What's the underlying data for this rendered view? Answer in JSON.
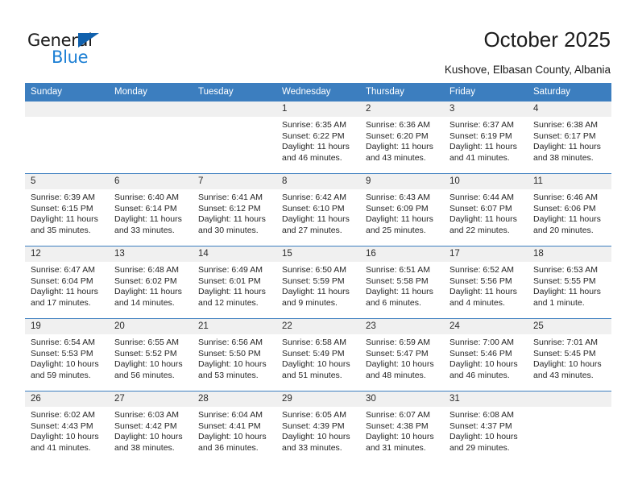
{
  "brand": {
    "name_top": "General",
    "name_bottom": "Blue",
    "triangle_color": "#1161ad",
    "blue_text_color": "#1c7fd4"
  },
  "header": {
    "title": "October 2025",
    "subtitle": "Kushove, Elbasan County, Albania"
  },
  "theme": {
    "header_blue": "#3c7ebf",
    "daynum_band": "#f0f0f0",
    "text_color": "#262626",
    "page_background": "#ffffff"
  },
  "calendar": {
    "weekday_headers": [
      "Sunday",
      "Monday",
      "Tuesday",
      "Wednesday",
      "Thursday",
      "Friday",
      "Saturday"
    ],
    "weeks": [
      [
        {
          "day": "",
          "empty": true
        },
        {
          "day": "",
          "empty": true
        },
        {
          "day": "",
          "empty": true
        },
        {
          "day": "1",
          "sunrise": "Sunrise: 6:35 AM",
          "sunset": "Sunset: 6:22 PM",
          "daylight": "Daylight: 11 hours and 46 minutes."
        },
        {
          "day": "2",
          "sunrise": "Sunrise: 6:36 AM",
          "sunset": "Sunset: 6:20 PM",
          "daylight": "Daylight: 11 hours and 43 minutes."
        },
        {
          "day": "3",
          "sunrise": "Sunrise: 6:37 AM",
          "sunset": "Sunset: 6:19 PM",
          "daylight": "Daylight: 11 hours and 41 minutes."
        },
        {
          "day": "4",
          "sunrise": "Sunrise: 6:38 AM",
          "sunset": "Sunset: 6:17 PM",
          "daylight": "Daylight: 11 hours and 38 minutes."
        }
      ],
      [
        {
          "day": "5",
          "sunrise": "Sunrise: 6:39 AM",
          "sunset": "Sunset: 6:15 PM",
          "daylight": "Daylight: 11 hours and 35 minutes."
        },
        {
          "day": "6",
          "sunrise": "Sunrise: 6:40 AM",
          "sunset": "Sunset: 6:14 PM",
          "daylight": "Daylight: 11 hours and 33 minutes."
        },
        {
          "day": "7",
          "sunrise": "Sunrise: 6:41 AM",
          "sunset": "Sunset: 6:12 PM",
          "daylight": "Daylight: 11 hours and 30 minutes."
        },
        {
          "day": "8",
          "sunrise": "Sunrise: 6:42 AM",
          "sunset": "Sunset: 6:10 PM",
          "daylight": "Daylight: 11 hours and 27 minutes."
        },
        {
          "day": "9",
          "sunrise": "Sunrise: 6:43 AM",
          "sunset": "Sunset: 6:09 PM",
          "daylight": "Daylight: 11 hours and 25 minutes."
        },
        {
          "day": "10",
          "sunrise": "Sunrise: 6:44 AM",
          "sunset": "Sunset: 6:07 PM",
          "daylight": "Daylight: 11 hours and 22 minutes."
        },
        {
          "day": "11",
          "sunrise": "Sunrise: 6:46 AM",
          "sunset": "Sunset: 6:06 PM",
          "daylight": "Daylight: 11 hours and 20 minutes."
        }
      ],
      [
        {
          "day": "12",
          "sunrise": "Sunrise: 6:47 AM",
          "sunset": "Sunset: 6:04 PM",
          "daylight": "Daylight: 11 hours and 17 minutes."
        },
        {
          "day": "13",
          "sunrise": "Sunrise: 6:48 AM",
          "sunset": "Sunset: 6:02 PM",
          "daylight": "Daylight: 11 hours and 14 minutes."
        },
        {
          "day": "14",
          "sunrise": "Sunrise: 6:49 AM",
          "sunset": "Sunset: 6:01 PM",
          "daylight": "Daylight: 11 hours and 12 minutes."
        },
        {
          "day": "15",
          "sunrise": "Sunrise: 6:50 AM",
          "sunset": "Sunset: 5:59 PM",
          "daylight": "Daylight: 11 hours and 9 minutes."
        },
        {
          "day": "16",
          "sunrise": "Sunrise: 6:51 AM",
          "sunset": "Sunset: 5:58 PM",
          "daylight": "Daylight: 11 hours and 6 minutes."
        },
        {
          "day": "17",
          "sunrise": "Sunrise: 6:52 AM",
          "sunset": "Sunset: 5:56 PM",
          "daylight": "Daylight: 11 hours and 4 minutes."
        },
        {
          "day": "18",
          "sunrise": "Sunrise: 6:53 AM",
          "sunset": "Sunset: 5:55 PM",
          "daylight": "Daylight: 11 hours and 1 minute."
        }
      ],
      [
        {
          "day": "19",
          "sunrise": "Sunrise: 6:54 AM",
          "sunset": "Sunset: 5:53 PM",
          "daylight": "Daylight: 10 hours and 59 minutes."
        },
        {
          "day": "20",
          "sunrise": "Sunrise: 6:55 AM",
          "sunset": "Sunset: 5:52 PM",
          "daylight": "Daylight: 10 hours and 56 minutes."
        },
        {
          "day": "21",
          "sunrise": "Sunrise: 6:56 AM",
          "sunset": "Sunset: 5:50 PM",
          "daylight": "Daylight: 10 hours and 53 minutes."
        },
        {
          "day": "22",
          "sunrise": "Sunrise: 6:58 AM",
          "sunset": "Sunset: 5:49 PM",
          "daylight": "Daylight: 10 hours and 51 minutes."
        },
        {
          "day": "23",
          "sunrise": "Sunrise: 6:59 AM",
          "sunset": "Sunset: 5:47 PM",
          "daylight": "Daylight: 10 hours and 48 minutes."
        },
        {
          "day": "24",
          "sunrise": "Sunrise: 7:00 AM",
          "sunset": "Sunset: 5:46 PM",
          "daylight": "Daylight: 10 hours and 46 minutes."
        },
        {
          "day": "25",
          "sunrise": "Sunrise: 7:01 AM",
          "sunset": "Sunset: 5:45 PM",
          "daylight": "Daylight: 10 hours and 43 minutes."
        }
      ],
      [
        {
          "day": "26",
          "sunrise": "Sunrise: 6:02 AM",
          "sunset": "Sunset: 4:43 PM",
          "daylight": "Daylight: 10 hours and 41 minutes."
        },
        {
          "day": "27",
          "sunrise": "Sunrise: 6:03 AM",
          "sunset": "Sunset: 4:42 PM",
          "daylight": "Daylight: 10 hours and 38 minutes."
        },
        {
          "day": "28",
          "sunrise": "Sunrise: 6:04 AM",
          "sunset": "Sunset: 4:41 PM",
          "daylight": "Daylight: 10 hours and 36 minutes."
        },
        {
          "day": "29",
          "sunrise": "Sunrise: 6:05 AM",
          "sunset": "Sunset: 4:39 PM",
          "daylight": "Daylight: 10 hours and 33 minutes."
        },
        {
          "day": "30",
          "sunrise": "Sunrise: 6:07 AM",
          "sunset": "Sunset: 4:38 PM",
          "daylight": "Daylight: 10 hours and 31 minutes."
        },
        {
          "day": "31",
          "sunrise": "Sunrise: 6:08 AM",
          "sunset": "Sunset: 4:37 PM",
          "daylight": "Daylight: 10 hours and 29 minutes."
        },
        {
          "day": "",
          "empty": true
        }
      ]
    ]
  }
}
